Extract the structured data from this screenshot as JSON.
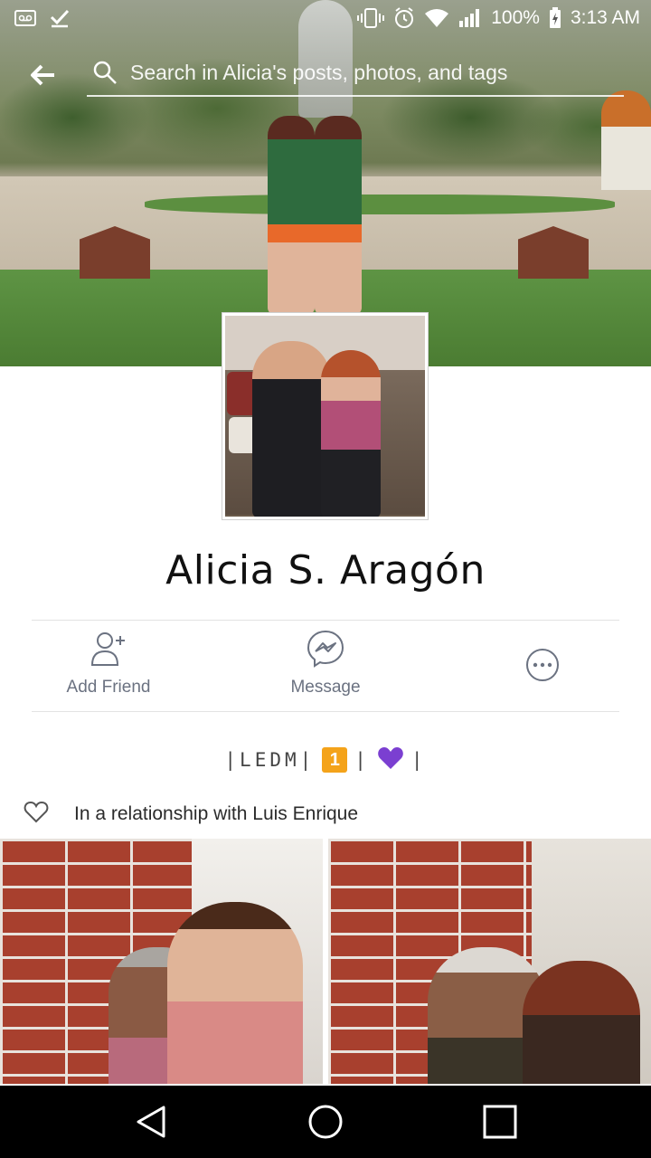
{
  "status_bar": {
    "battery": "100%",
    "time": "3:13 AM"
  },
  "search": {
    "placeholder": "Search in Alicia's posts, photos, and tags"
  },
  "profile": {
    "name": "Alicia S. Aragón"
  },
  "actions": {
    "add_friend": "Add Friend",
    "message": "Message"
  },
  "bio": {
    "before": "|LEDM|",
    "badge": "1",
    "middle": "|",
    "after": "|"
  },
  "relationship": {
    "text": "In a relationship with Luis Enrique"
  },
  "colors": {
    "accent_purple": "#7b3fd1",
    "icon_gray": "#6b7281",
    "badge_orange": "#f4a31a"
  },
  "icons": [
    "voicemail-icon",
    "check-icon",
    "vibrate-icon",
    "alarm-icon",
    "wifi-icon",
    "signal-icon",
    "battery-icon",
    "back-arrow-icon",
    "search-icon",
    "add-friend-icon",
    "messenger-icon",
    "more-icon",
    "heart-icon",
    "nav-back-icon",
    "nav-home-icon",
    "nav-recents-icon"
  ]
}
